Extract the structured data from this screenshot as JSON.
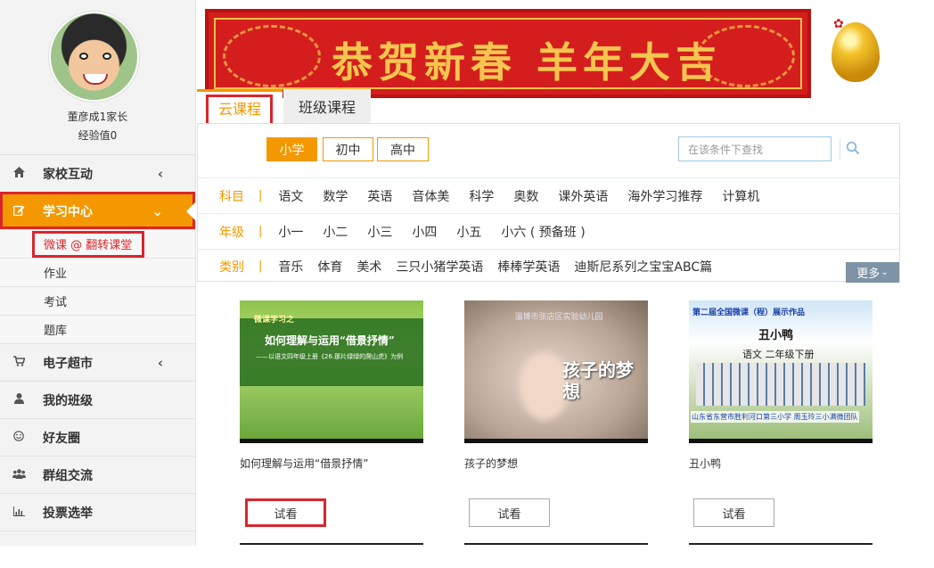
{
  "sidebar": {
    "username": "董彦成1家长",
    "experience": "经验值0",
    "nav": [
      {
        "label": "家校互动",
        "icon": "home-icon"
      },
      {
        "label": "学习中心",
        "icon": "edit-icon",
        "active": true
      },
      {
        "label": "电子超市",
        "icon": "cart-icon"
      },
      {
        "label": "我的班级",
        "icon": "user-icon"
      },
      {
        "label": "好友圈",
        "icon": "smile-icon"
      },
      {
        "label": "群组交流",
        "icon": "group-icon"
      },
      {
        "label": "投票选举",
        "icon": "bar-chart-icon"
      }
    ],
    "subnav": [
      "微课 @ 翻转课堂",
      "作业",
      "考试",
      "题库"
    ]
  },
  "banner": {
    "text": "恭贺新春  羊年大吉"
  },
  "tabs": [
    "云课程",
    "班级课程"
  ],
  "levels": [
    "小学",
    "初中",
    "高中"
  ],
  "search": {
    "placeholder": "在该条件下查找"
  },
  "filters": {
    "subject": {
      "label": "科目",
      "options": [
        "语文",
        "数学",
        "英语",
        "音体美",
        "科学",
        "奥数",
        "课外英语",
        "海外学习推荐",
        "计算机"
      ]
    },
    "grade": {
      "label": "年级",
      "options": [
        "小一",
        "小二",
        "小三",
        "小四",
        "小五",
        "小六 ( 预备班 )"
      ]
    },
    "category": {
      "label": "类别",
      "options": [
        "音乐",
        "体育",
        "美术",
        "三只小猪学英语",
        "棒棒学英语",
        "迪斯尼系列之宝宝ABC篇"
      ]
    },
    "more_label": "更多"
  },
  "courses": [
    {
      "title": "如何理解与运用“借景抒情”",
      "thumb": {
        "line1": "微课学习之",
        "line2": "如何理解与运用“借景抒情”",
        "line3": "——以语文四年级上册《26.那片绿绿的爬山虎》为例"
      },
      "button": "试看"
    },
    {
      "title": "孩子的梦想",
      "thumb": {
        "line1": "淄博市张店区实验幼儿园",
        "line2": "孩子的梦想"
      },
      "button": "试看"
    },
    {
      "title": "丑小鸭",
      "thumb": {
        "line1": "第二届全国微课（程）展示作品",
        "line2": "丑小鸭",
        "line3": "语文  二年级下册",
        "line4": "山东省东营市胜利河口第三小学 周玉玲三小满微团队"
      },
      "button": "试看"
    }
  ],
  "colors": {
    "accent": "#f39800",
    "highlight": "#d9262c",
    "banner_red": "#d41e1e",
    "banner_gold": "#f4c64f"
  }
}
